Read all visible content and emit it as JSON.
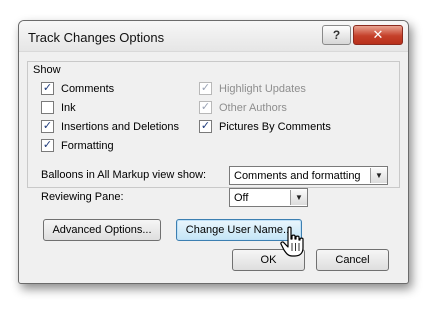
{
  "dialog": {
    "title": "Track Changes Options",
    "help_button": "?",
    "close_button": "✕"
  },
  "show_group": {
    "label": "Show",
    "checkboxes": [
      {
        "label": "Comments",
        "checked": true,
        "enabled": true
      },
      {
        "label": "Ink",
        "checked": false,
        "enabled": true
      },
      {
        "label": "Insertions and Deletions",
        "checked": true,
        "enabled": true
      },
      {
        "label": "Formatting",
        "checked": true,
        "enabled": true
      },
      {
        "label": "Highlight Updates",
        "checked": true,
        "enabled": false
      },
      {
        "label": "Other Authors",
        "checked": true,
        "enabled": false
      },
      {
        "label": "Pictures By Comments",
        "checked": true,
        "enabled": true
      }
    ],
    "balloons_label": "Balloons in All Markup view show:",
    "balloons_value": "Comments and formatting",
    "reviewing_pane_label": "Reviewing Pane:",
    "reviewing_pane_value": "Off"
  },
  "buttons": {
    "advanced": "Advanced Options...",
    "change_user": "Change User Name...",
    "ok": "OK",
    "cancel": "Cancel"
  },
  "icons": {
    "check": "✓",
    "dropdown": "▼",
    "cursor": "hand-pointer-icon"
  }
}
